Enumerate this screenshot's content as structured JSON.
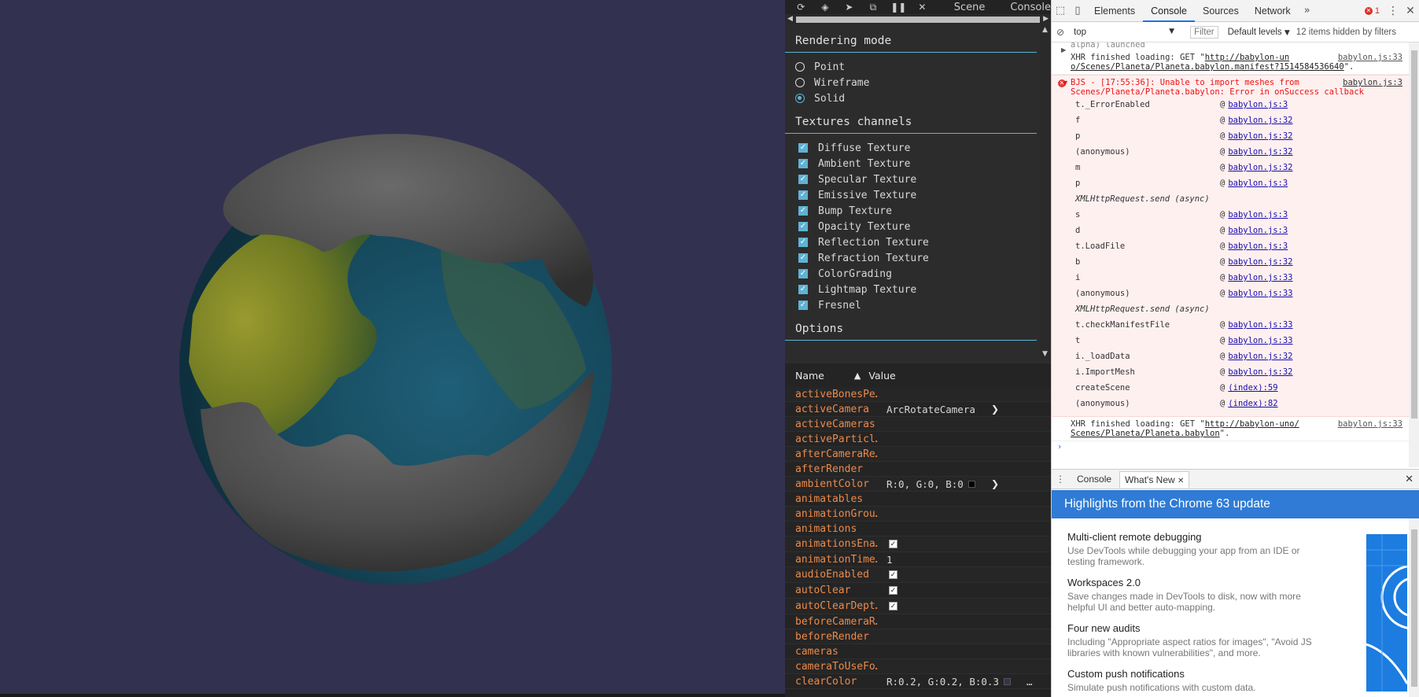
{
  "inspector": {
    "toolbar": {
      "icons": [
        "refresh-icon",
        "tag-icon",
        "pointer-icon",
        "popout-icon",
        "pause-icon",
        "close-icon"
      ],
      "tabs": [
        "Scene",
        "Console"
      ]
    },
    "rendering_mode": {
      "title": "Rendering mode",
      "options": [
        "Point",
        "Wireframe",
        "Solid"
      ],
      "selected": "Solid"
    },
    "textures": {
      "title": "Textures channels",
      "items": [
        "Diffuse Texture",
        "Ambient Texture",
        "Specular Texture",
        "Emissive Texture",
        "Bump Texture",
        "Opacity Texture",
        "Reflection Texture",
        "Refraction Texture",
        "ColorGrading",
        "Lightmap Texture",
        "Fresnel"
      ]
    },
    "options_title": "Options",
    "properties": {
      "name_header": "Name",
      "value_header": "Value",
      "rows": [
        {
          "name": "activeBonesPe…",
          "value": ""
        },
        {
          "name": "activeCamera",
          "value": "ArcRotateCamera",
          "expand": true
        },
        {
          "name": "activeCameras",
          "value": ""
        },
        {
          "name": "activeParticl…",
          "value": ""
        },
        {
          "name": "afterCameraRe…",
          "value": ""
        },
        {
          "name": "afterRender",
          "value": ""
        },
        {
          "name": "ambientColor",
          "value": "R:0, G:0, B:0",
          "swatch": "#000000",
          "expand": true
        },
        {
          "name": "animatables",
          "value": ""
        },
        {
          "name": "animationGrou…",
          "value": ""
        },
        {
          "name": "animations",
          "value": ""
        },
        {
          "name": "animationsEna…",
          "value": "",
          "check": true
        },
        {
          "name": "animationTime…",
          "value": "1"
        },
        {
          "name": "audioEnabled",
          "value": "",
          "check": true
        },
        {
          "name": "autoClear",
          "value": "",
          "check": true
        },
        {
          "name": "autoClearDept…",
          "value": "",
          "check": true
        },
        {
          "name": "beforeCameraR…",
          "value": ""
        },
        {
          "name": "beforeRender",
          "value": ""
        },
        {
          "name": "cameras",
          "value": ""
        },
        {
          "name": "cameraToUseFo…",
          "value": ""
        },
        {
          "name": "clearColor",
          "value": "R:0.2, G:0.2, B:0.3",
          "swatch": "#333350",
          "more": "…"
        }
      ]
    }
  },
  "devtools": {
    "tabs": [
      "Elements",
      "Console",
      "Sources",
      "Network"
    ],
    "active_tab": "Console",
    "error_count": "1",
    "filter": {
      "context": "top",
      "filter_placeholder": "Filter",
      "levels": "Default levels",
      "hidden": "12 items hidden by filters"
    },
    "console": {
      "cut_line": "alpha) launched",
      "log1": {
        "text": "XHR finished loading: GET \"",
        "url": "http://babylon-un",
        "source": "babylon.js:33",
        "cont": "o/Scenes/Planeta/Planeta.babylon.manifest?1514584536640",
        "cont_end": "\"."
      },
      "error": {
        "source": "babylon.js:3",
        "line1": "BJS - [17:55:36]: Unable to import meshes from ",
        "line2": "Scenes/Planeta/Planeta.babylon: Error in onSuccess callback",
        "stack": [
          {
            "fn": "t._ErrorEnabled",
            "src": "babylon.js:3"
          },
          {
            "fn": "f",
            "src": "babylon.js:32"
          },
          {
            "fn": "p",
            "src": "babylon.js:32"
          },
          {
            "fn": "(anonymous)",
            "src": "babylon.js:32"
          },
          {
            "fn": "m",
            "src": "babylon.js:32"
          },
          {
            "fn": "p",
            "src": "babylon.js:3"
          },
          {
            "sep": "XMLHttpRequest.send (async)"
          },
          {
            "fn": "s",
            "src": "babylon.js:3"
          },
          {
            "fn": "d",
            "src": "babylon.js:3"
          },
          {
            "fn": "t.LoadFile",
            "src": "babylon.js:3"
          },
          {
            "fn": "b",
            "src": "babylon.js:32"
          },
          {
            "fn": "i",
            "src": "babylon.js:33"
          },
          {
            "fn": "(anonymous)",
            "src": "babylon.js:33"
          },
          {
            "sep": "XMLHttpRequest.send (async)"
          },
          {
            "fn": "t.checkManifestFile",
            "src": "babylon.js:33"
          },
          {
            "fn": "t",
            "src": "babylon.js:33"
          },
          {
            "fn": "i._loadData",
            "src": "babylon.js:32"
          },
          {
            "fn": "i.ImportMesh",
            "src": "babylon.js:32"
          },
          {
            "fn": "createScene",
            "src": "(index):59"
          },
          {
            "fn": "(anonymous)",
            "src": "(index):82"
          }
        ]
      },
      "log2": {
        "text": "XHR finished loading: GET \"",
        "url": "http://babylon-uno/",
        "source": "babylon.js:33",
        "cont": "Scenes/Planeta/Planeta.babylon",
        "cont_end": "\"."
      },
      "prompt": "›"
    },
    "drawer": {
      "tabs": [
        "Console",
        "What's New"
      ],
      "active_tab": "What's New",
      "banner": "Highlights from the Chrome 63 update",
      "items": [
        {
          "title": "Multi-client remote debugging",
          "desc": "Use DevTools while debugging your app from an IDE or testing framework."
        },
        {
          "title": "Workspaces 2.0",
          "desc": "Save changes made in DevTools to disk, now with more helpful UI and better auto-mapping."
        },
        {
          "title": "Four new audits",
          "desc": "Including \"Appropriate aspect ratios for images\", \"Avoid JS libraries with known vulnerabilities\", and more."
        },
        {
          "title": "Custom push notifications",
          "desc": "Simulate push notifications with custom data."
        }
      ]
    }
  },
  "colors": {
    "viewport_bg": "#333150",
    "accent": "#5fb2d4",
    "prop_name": "#ec8a4a",
    "error": "#e11111",
    "devtools_blue": "#2f7bd5"
  }
}
